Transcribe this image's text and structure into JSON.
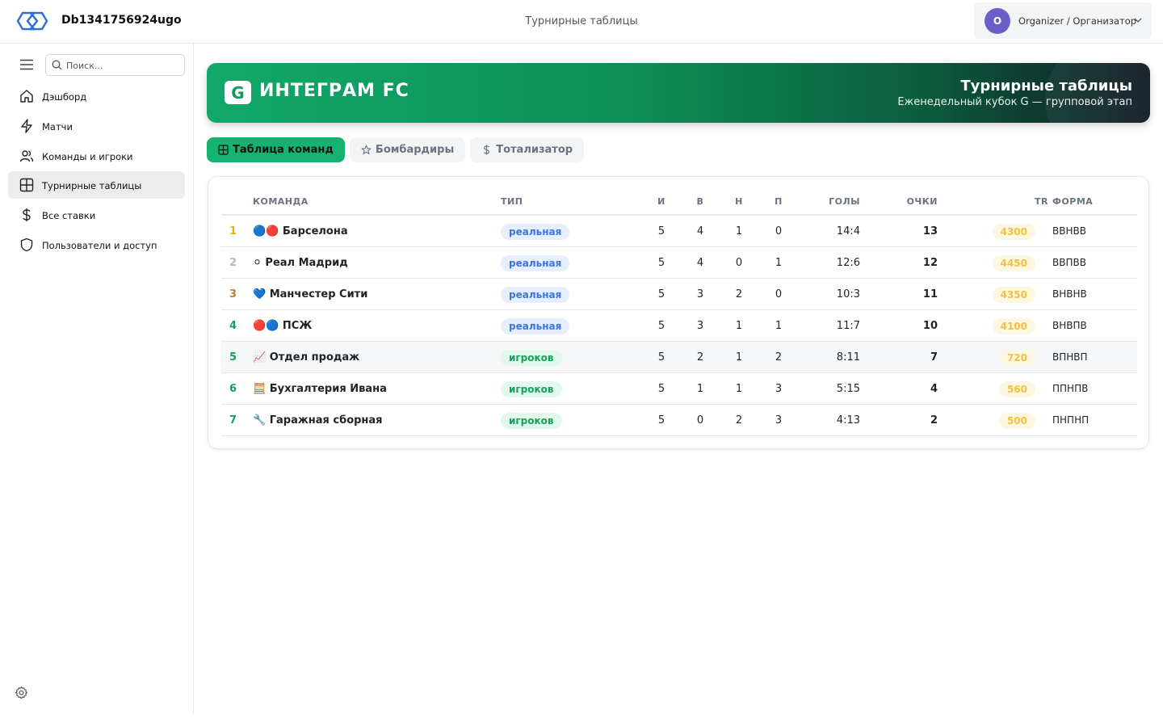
{
  "header": {
    "app_title": "Db1341756924ugo",
    "page_heading": "Турнирные таблицы",
    "user_initial": "O",
    "user_role": "Organizer / Организатор"
  },
  "sidebar": {
    "search_placeholder": "Поиск...",
    "items": [
      {
        "label": "Дэшборд",
        "icon": "home-icon"
      },
      {
        "label": "Матчи",
        "icon": "lightning-icon"
      },
      {
        "label": "Команды и игроки",
        "icon": "users-icon"
      },
      {
        "label": "Турнирные таблицы",
        "icon": "table-icon"
      },
      {
        "label": "Все ставки",
        "icon": "dollar-icon"
      },
      {
        "label": "Пользователи и доступ",
        "icon": "shield-icon"
      }
    ]
  },
  "banner": {
    "badge": "G",
    "brand": "ИНТЕГРАМ FC",
    "title": "Турнирные таблицы",
    "subtitle": "Еженедельный кубок G — групповой этап"
  },
  "tabs": [
    {
      "label": "Таблица команд",
      "icon": "grid-icon"
    },
    {
      "label": "Бомбардиры",
      "icon": "star-icon"
    },
    {
      "label": "Тотализатор",
      "icon": "dollar-icon"
    }
  ],
  "table": {
    "headers": {
      "team": "КОМАНДА",
      "type": "ТИП",
      "played": "И",
      "won": "В",
      "drawn": "Н",
      "lost": "П",
      "goals": "ГОЛЫ",
      "points": "ОЧКИ",
      "tr": "TR",
      "form": "ФОРМА"
    },
    "rows": [
      {
        "rank": "1",
        "team": "🔵🔴 Барселона",
        "type": "реальная",
        "played": "5",
        "won": "4",
        "drawn": "1",
        "lost": "0",
        "goals": "14:4",
        "points": "13",
        "tr": "4300",
        "form": "ВВНВВ"
      },
      {
        "rank": "2",
        "team": "⚪ Реал Мадрид",
        "type": "реальная",
        "played": "5",
        "won": "4",
        "drawn": "0",
        "lost": "1",
        "goals": "12:6",
        "points": "12",
        "tr": "4450",
        "form": "ВВПВВ"
      },
      {
        "rank": "3",
        "team": "💙 Манчестер Сити",
        "type": "реальная",
        "played": "5",
        "won": "3",
        "drawn": "2",
        "lost": "0",
        "goals": "10:3",
        "points": "11",
        "tr": "4350",
        "form": "ВНВНВ"
      },
      {
        "rank": "4",
        "team": "🔴🔵 ПСЖ",
        "type": "реальная",
        "played": "5",
        "won": "3",
        "drawn": "1",
        "lost": "1",
        "goals": "11:7",
        "points": "10",
        "tr": "4100",
        "form": "ВНВПВ"
      },
      {
        "rank": "5",
        "team": "📈 Отдел продаж",
        "type": "игроков",
        "played": "5",
        "won": "2",
        "drawn": "1",
        "lost": "2",
        "goals": "8:11",
        "points": "7",
        "tr": "720",
        "form": "ВПНВП"
      },
      {
        "rank": "6",
        "team": "🧮 Бухгалтерия Ивана",
        "type": "игроков",
        "played": "5",
        "won": "1",
        "drawn": "1",
        "lost": "3",
        "goals": "5:15",
        "points": "4",
        "tr": "560",
        "form": "ППНПВ"
      },
      {
        "rank": "7",
        "team": "🔧 Гаражная сборная",
        "type": "игроков",
        "played": "5",
        "won": "0",
        "drawn": "2",
        "lost": "3",
        "goals": "4:13",
        "points": "2",
        "tr": "500",
        "form": "ПНПНП"
      }
    ],
    "rank_colors": [
      "#e8b400",
      "#b0b8c4",
      "#c8782c",
      "#16a05c",
      "#16a05c",
      "#16a05c",
      "#16a05c"
    ]
  },
  "colors": {
    "accent": "#16b26f",
    "avatar": "#6b5fc7"
  }
}
